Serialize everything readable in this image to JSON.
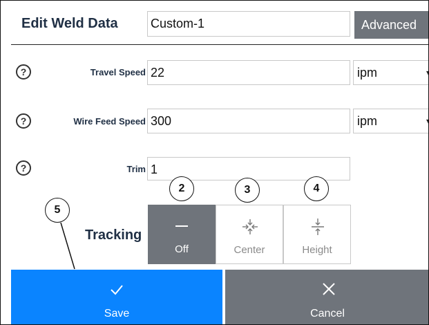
{
  "header": {
    "title": "Edit Weld Data",
    "name_value": "Custom-1",
    "advanced_label": "Advanced"
  },
  "fields": [
    {
      "help": "?",
      "label": "Travel Speed",
      "value": "22",
      "unit": "ipm"
    },
    {
      "help": "?",
      "label": "Wire Feed Speed",
      "value": "300",
      "unit": "ipm"
    },
    {
      "help": "?",
      "label": "Trim",
      "value": "1"
    }
  ],
  "tracking": {
    "label": "Tracking",
    "options": [
      {
        "label": "Off",
        "selected": true
      },
      {
        "label": "Center",
        "selected": false
      },
      {
        "label": "Height",
        "selected": false
      }
    ]
  },
  "footer": {
    "save_label": "Save",
    "cancel_label": "Cancel"
  },
  "callouts": [
    "2",
    "3",
    "4",
    "5"
  ],
  "colors": {
    "title": "#1f2f44",
    "advanced_bg": "#6f747b",
    "tracking_selected_bg": "#6f747b",
    "save_bg": "#0a84ff",
    "cancel_bg": "#6f747b"
  }
}
